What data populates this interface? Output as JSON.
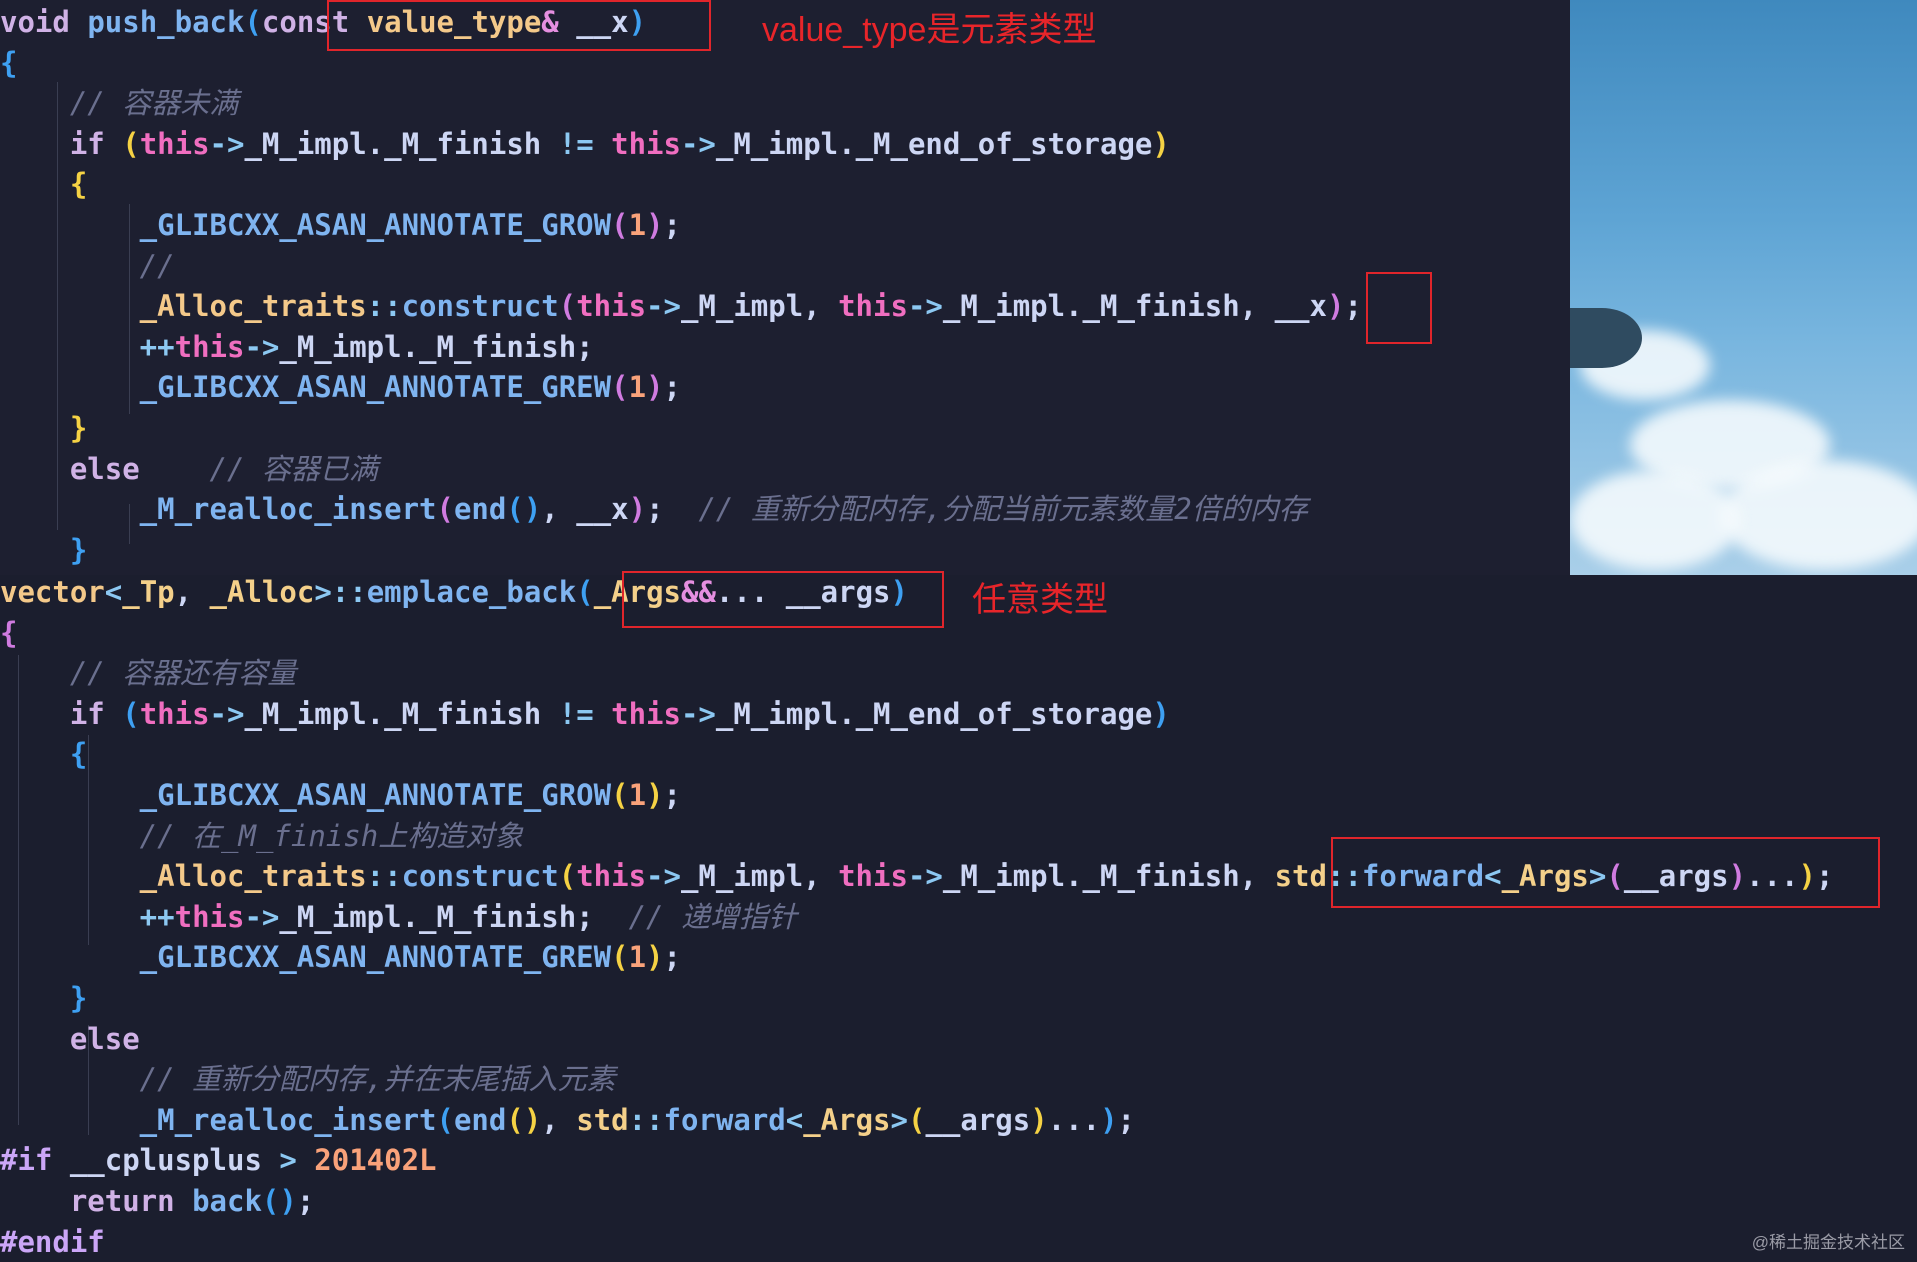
{
  "colors": {
    "editor_background": "#1d1f30",
    "annotation_red": "#e8252a",
    "keyword": "#d0b2e6",
    "function": "#7fb4f0",
    "this_keyword": "#f06ec0",
    "comment": "#6a6f8e",
    "number": "#f9a27a"
  },
  "push_back": {
    "lines": [
      [
        [
          "t-kw",
          "void "
        ],
        [
          "t-fn",
          "push_back"
        ],
        [
          "t-p3",
          "("
        ],
        [
          "t-kw",
          "const "
        ],
        [
          "t-type",
          "value_type"
        ],
        [
          "t-amp",
          "&"
        ],
        [
          "t-var",
          " __x"
        ],
        [
          "t-p3",
          ")"
        ]
      ],
      [
        [
          "t-p3",
          "{"
        ]
      ],
      [
        [
          "t-cm",
          "    // 容器未满"
        ]
      ],
      [
        [
          "t-kw",
          "    if "
        ],
        [
          "t-p1",
          "("
        ],
        [
          "t-this",
          "this"
        ],
        [
          "t-op",
          "->"
        ],
        [
          "t-var",
          "_M_impl._M_finish "
        ],
        [
          "t-op",
          "!= "
        ],
        [
          "t-this",
          "this"
        ],
        [
          "t-op",
          "->"
        ],
        [
          "t-var",
          "_M_impl._M_end_of_storage"
        ],
        [
          "t-p1",
          ")"
        ]
      ],
      [
        [
          "t-p1",
          "    {"
        ]
      ],
      [
        [
          "t-fn",
          "        _GLIBCXX_ASAN_ANNOTATE_GROW"
        ],
        [
          "t-p2",
          "("
        ],
        [
          "t-num",
          "1"
        ],
        [
          "t-p2",
          ")"
        ],
        [
          "t-punc",
          ";"
        ]
      ],
      [
        [
          "t-cm",
          "        //"
        ]
      ],
      [
        [
          "t-type",
          "        _Alloc_traits"
        ],
        [
          "t-op",
          "::"
        ],
        [
          "t-fn",
          "construct"
        ],
        [
          "t-p2",
          "("
        ],
        [
          "t-this",
          "this"
        ],
        [
          "t-op",
          "->"
        ],
        [
          "t-var",
          "_M_impl, "
        ],
        [
          "t-this",
          "this"
        ],
        [
          "t-op",
          "->"
        ],
        [
          "t-var",
          "_M_impl._M_finish, __x"
        ],
        [
          "t-p2",
          ")"
        ],
        [
          "t-punc",
          ";"
        ]
      ],
      [
        [
          "t-op",
          "        ++"
        ],
        [
          "t-this",
          "this"
        ],
        [
          "t-op",
          "->"
        ],
        [
          "t-var",
          "_M_impl._M_finish;"
        ]
      ],
      [
        [
          "t-fn",
          "        _GLIBCXX_ASAN_ANNOTATE_GREW"
        ],
        [
          "t-p2",
          "("
        ],
        [
          "t-num",
          "1"
        ],
        [
          "t-p2",
          ")"
        ],
        [
          "t-punc",
          ";"
        ]
      ],
      [
        [
          "t-p1",
          "    }"
        ]
      ],
      [
        [
          "t-kw",
          "    else    "
        ],
        [
          "t-cm",
          "// 容器已满"
        ]
      ],
      [
        [
          "t-fn",
          "        _M_realloc_insert"
        ],
        [
          "t-p2",
          "("
        ],
        [
          "t-fn",
          "end"
        ],
        [
          "t-p3",
          "()"
        ],
        [
          "t-var",
          ", __x"
        ],
        [
          "t-p2",
          ")"
        ],
        [
          "t-punc",
          ";  "
        ],
        [
          "t-cm",
          "// 重新分配内存,分配当前元素数量2倍的内存"
        ]
      ],
      [
        [
          "t-p3",
          "    }"
        ]
      ]
    ]
  },
  "emplace_back": {
    "lines": [
      [
        [
          "t-type",
          "vector"
        ],
        [
          "t-op",
          "<"
        ],
        [
          "t-tmpl",
          "_Tp"
        ],
        [
          "t-var",
          ", "
        ],
        [
          "t-tmpl",
          "_Alloc"
        ],
        [
          "t-op",
          ">::"
        ],
        [
          "t-fn",
          "emplace_back"
        ],
        [
          "t-p3",
          "("
        ],
        [
          "t-tmpl",
          "_Args"
        ],
        [
          "t-amp",
          "&&"
        ],
        [
          "t-var",
          "... __args"
        ],
        [
          "t-p3",
          ")"
        ]
      ],
      [
        [
          "t-p2",
          "{"
        ]
      ],
      [
        [
          "t-cm",
          "    // 容器还有容量"
        ]
      ],
      [
        [
          "t-kw",
          "    if "
        ],
        [
          "t-p3",
          "("
        ],
        [
          "t-this",
          "this"
        ],
        [
          "t-op",
          "->"
        ],
        [
          "t-var",
          "_M_impl._M_finish "
        ],
        [
          "t-op",
          "!= "
        ],
        [
          "t-this",
          "this"
        ],
        [
          "t-op",
          "->"
        ],
        [
          "t-var",
          "_M_impl._M_end_of_storage"
        ],
        [
          "t-p3",
          ")"
        ]
      ],
      [
        [
          "t-p3",
          "    {"
        ]
      ],
      [
        [
          "t-fn",
          "        _GLIBCXX_ASAN_ANNOTATE_GROW"
        ],
        [
          "t-p1",
          "("
        ],
        [
          "t-num",
          "1"
        ],
        [
          "t-p1",
          ")"
        ],
        [
          "t-punc",
          ";"
        ]
      ],
      [
        [
          "t-cm",
          "        // 在_M_finish上构造对象"
        ]
      ],
      [
        [
          "t-type",
          "        _Alloc_traits"
        ],
        [
          "t-op",
          "::"
        ],
        [
          "t-fn",
          "construct"
        ],
        [
          "t-p1",
          "("
        ],
        [
          "t-this",
          "this"
        ],
        [
          "t-op",
          "->"
        ],
        [
          "t-var",
          "_M_impl, "
        ],
        [
          "t-this",
          "this"
        ],
        [
          "t-op",
          "->"
        ],
        [
          "t-var",
          "_M_impl._M_finish, "
        ],
        [
          "t-tmpl",
          "std"
        ],
        [
          "t-op",
          "::"
        ],
        [
          "t-fn",
          "forward"
        ],
        [
          "t-op",
          "<"
        ],
        [
          "t-tmpl",
          "_Args"
        ],
        [
          "t-op",
          ">"
        ],
        [
          "t-p2",
          "("
        ],
        [
          "t-var",
          "__args"
        ],
        [
          "t-p2",
          ")"
        ],
        [
          "t-var",
          "..."
        ],
        [
          "t-p1",
          ")"
        ],
        [
          "t-punc",
          ";"
        ]
      ],
      [
        [
          "t-op",
          "        ++"
        ],
        [
          "t-this",
          "this"
        ],
        [
          "t-op",
          "->"
        ],
        [
          "t-var",
          "_M_impl._M_finish;  "
        ],
        [
          "t-cm",
          "// 递增指针"
        ]
      ],
      [
        [
          "t-fn",
          "        _GLIBCXX_ASAN_ANNOTATE_GREW"
        ],
        [
          "t-p1",
          "("
        ],
        [
          "t-num",
          "1"
        ],
        [
          "t-p1",
          ")"
        ],
        [
          "t-punc",
          ";"
        ]
      ],
      [
        [
          "t-p3",
          "    }"
        ]
      ],
      [
        [
          "t-kw",
          "    else"
        ]
      ],
      [
        [
          "t-cm",
          "        // 重新分配内存,并在末尾插入元素"
        ]
      ],
      [
        [
          "t-fn",
          "        _M_realloc_insert"
        ],
        [
          "t-p3",
          "("
        ],
        [
          "t-fn",
          "end"
        ],
        [
          "t-p1",
          "()"
        ],
        [
          "t-var",
          ", "
        ],
        [
          "t-tmpl",
          "std"
        ],
        [
          "t-op",
          "::"
        ],
        [
          "t-fn",
          "forward"
        ],
        [
          "t-op",
          "<"
        ],
        [
          "t-tmpl",
          "_Args"
        ],
        [
          "t-op",
          ">"
        ],
        [
          "t-p1",
          "("
        ],
        [
          "t-var",
          "__args"
        ],
        [
          "t-p1",
          ")"
        ],
        [
          "t-var",
          "..."
        ],
        [
          "t-p3",
          ")"
        ],
        [
          "t-punc",
          ";"
        ]
      ],
      [
        [
          "t-pre",
          "#if "
        ],
        [
          "t-var",
          "__cplusplus "
        ],
        [
          "t-op",
          "> "
        ],
        [
          "t-num",
          "201402L"
        ]
      ],
      [
        [
          "t-kw",
          "    return "
        ],
        [
          "t-fn",
          "back"
        ],
        [
          "t-p3",
          "()"
        ],
        [
          "t-punc",
          ";"
        ]
      ],
      [
        [
          "t-pre",
          "#endif"
        ]
      ]
    ]
  },
  "annotations": {
    "value_type_note": "value_type是元素类型",
    "args_note": "任意类型"
  },
  "watermark": "@稀土掘金技术社区"
}
